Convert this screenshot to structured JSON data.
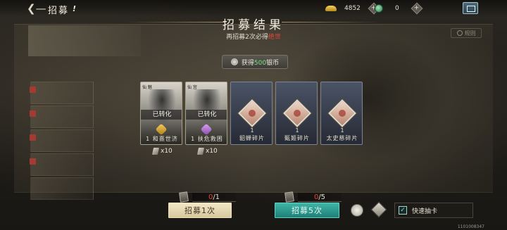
{
  "header": {
    "title": "招募",
    "info_glyph": "!",
    "currencies": [
      {
        "icon": "gold-ingot-icon",
        "value": "4852"
      },
      {
        "icon": "jade-icon",
        "value": "0"
      }
    ],
    "plus_glyph": "+"
  },
  "result": {
    "title": "招募结果",
    "subtitle_prefix": "再招募2次必得",
    "subtitle_highlight": "绝世",
    "rules_label": "规则",
    "gain_prefix": "获得",
    "gain_amount": "500",
    "gain_suffix": "银币"
  },
  "cards": [
    {
      "type": "hero",
      "corner": "仙 魅",
      "status": "已转化",
      "name": "1 和熹世济",
      "glyph": "gold",
      "mult": "x10"
    },
    {
      "type": "hero",
      "corner": "仙 宫",
      "status": "已转化",
      "name": "1 扶危救困",
      "glyph": "purple",
      "mult": "x10"
    },
    {
      "type": "fragment",
      "count": "1",
      "name": "貂蝉碎片"
    },
    {
      "type": "fragment",
      "count": "1",
      "name": "甄姬碎片"
    },
    {
      "type": "fragment",
      "count": "1",
      "name": "太史慈碎片"
    }
  ],
  "bottom": {
    "once_counter_cur": "0",
    "once_counter_total": "/1",
    "five_counter_cur": "0",
    "five_counter_total": "/5",
    "once_button": "招募1次",
    "five_button": "招募5次",
    "fast_draw_label": "快速抽卡",
    "fast_draw_checked_glyph": "✓",
    "build_id": "1101008347"
  },
  "colors": {
    "highlight_red": "#e0473a",
    "gain_green": "#7fe08a",
    "teal_button": "#2a9a8e",
    "cream_button": "#e6dab4"
  }
}
